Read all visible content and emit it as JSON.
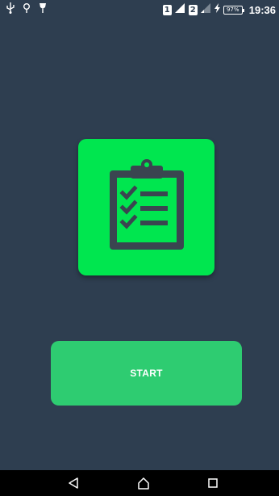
{
  "status_bar": {
    "left_icons": [
      "usb-icon",
      "gps-icon",
      "notification-icon"
    ],
    "sim1_label": "1",
    "sim2_label": "2",
    "battery_level": "97%",
    "time": "19:36"
  },
  "main": {
    "app_icon": "clipboard-checklist-icon",
    "start_label": "START"
  },
  "nav_bar": {
    "icons": [
      "back-icon",
      "home-icon",
      "recents-icon"
    ]
  },
  "colors": {
    "background": "#2e3e50",
    "icon_tile": "#00e64f",
    "start_button": "#2ecc71",
    "icon_glyph": "#3a4550"
  }
}
